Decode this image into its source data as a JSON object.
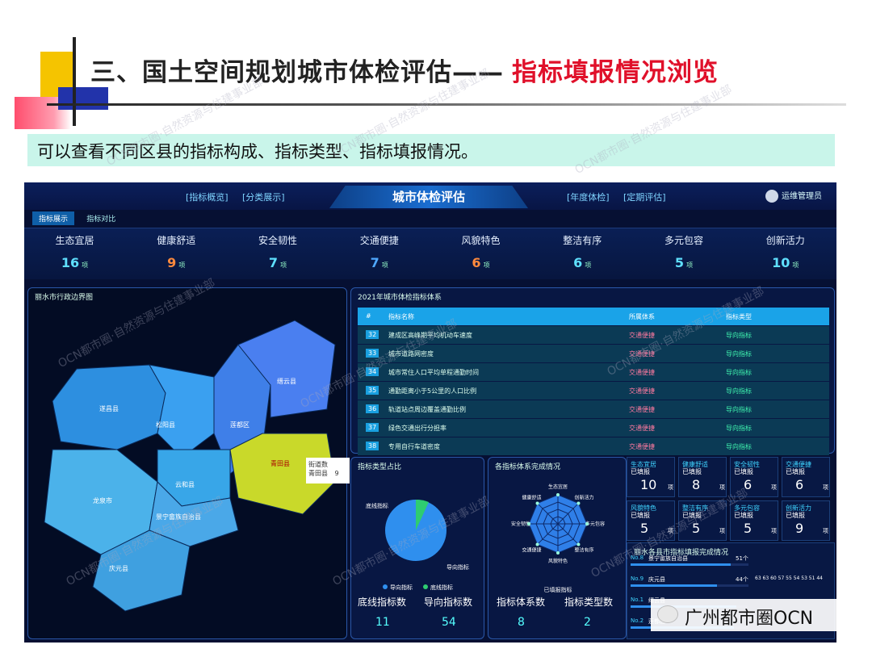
{
  "header": {
    "title": "三、国土空间规划城市体检评估——",
    "title_highlight": "指标填报情况浏览",
    "subtitle": "可以查看不同区县的指标构成、指标类型、指标填报情况。"
  },
  "dashboard": {
    "nav_left": [
      "[指标概览]",
      "[分类展示]"
    ],
    "center_title": "城市体检评估",
    "nav_right": [
      "[年度体检]",
      "[定期评估]"
    ],
    "user": "运维管理员",
    "subtabs": [
      "指标展示",
      "指标对比"
    ],
    "stats": [
      {
        "label": "生态宜居",
        "value": "16",
        "unit": "项",
        "color": "#5fe0ff"
      },
      {
        "label": "健康舒适",
        "value": "9",
        "unit": "项",
        "color": "#ff8a3d"
      },
      {
        "label": "安全韧性",
        "value": "7",
        "unit": "项",
        "color": "#5fe0ff"
      },
      {
        "label": "交通便捷",
        "value": "7",
        "unit": "项",
        "color": "#4fa8ff"
      },
      {
        "label": "风貌特色",
        "value": "6",
        "unit": "项",
        "color": "#ff8a3d"
      },
      {
        "label": "整洁有序",
        "value": "6",
        "unit": "项",
        "color": "#5fe0ff"
      },
      {
        "label": "多元包容",
        "value": "5",
        "unit": "项",
        "color": "#5fe0ff"
      },
      {
        "label": "创新活力",
        "value": "10",
        "unit": "项",
        "color": "#5fe0ff"
      }
    ],
    "map": {
      "title": "丽水市行政边界图",
      "regions": [
        "遂昌县",
        "松阳县",
        "莲都区",
        "缙云县",
        "青田县",
        "云和县",
        "龙泉市",
        "景宁畲族自治县",
        "庆元县"
      ],
      "tooltip": {
        "label": "街道数",
        "region": "青田县",
        "value": "9"
      }
    },
    "table": {
      "title": "2021年城市体检指标体系",
      "headers": [
        "#",
        "指标名称",
        "所属体系",
        "指标类型"
      ],
      "rows": [
        {
          "n": "32",
          "name": "建成区高峰期平均机动车速度",
          "system": "交通便捷",
          "type": "导向指标"
        },
        {
          "n": "33",
          "name": "城市道路网密度",
          "system": "交通便捷",
          "type": "导向指标"
        },
        {
          "n": "34",
          "name": "城市常住人口平均单程通勤时间",
          "system": "交通便捷",
          "type": "导向指标"
        },
        {
          "n": "35",
          "name": "通勤距离小于5公里的人口比例",
          "system": "交通便捷",
          "type": "导向指标"
        },
        {
          "n": "36",
          "name": "轨道站点周边覆盖通勤比例",
          "system": "交通便捷",
          "type": "导向指标"
        },
        {
          "n": "37",
          "name": "绿色交通出行分担率",
          "system": "交通便捷",
          "type": "导向指标"
        },
        {
          "n": "38",
          "name": "专用自行车道密度",
          "system": "交通便捷",
          "type": "导向指标"
        }
      ]
    },
    "pie": {
      "title": "指标类型占比",
      "legend": [
        "导向指标",
        "底线指标"
      ],
      "labels": [
        "底线指标",
        "导向指标"
      ],
      "bottom": [
        {
          "label": "底线指标数",
          "value": "11"
        },
        {
          "label": "导向指标数",
          "value": "54"
        }
      ]
    },
    "radar": {
      "title": "各指标体系完成情况",
      "axes": [
        "生态宜居",
        "创新活力",
        "多元包容",
        "整洁有序",
        "风貌特色",
        "交通便捷",
        "安全韧性",
        "健康舒适"
      ],
      "legend": "已填报指标",
      "bottom": [
        {
          "label": "指标体系数",
          "value": "8"
        },
        {
          "label": "指标类型数",
          "value": "2"
        }
      ]
    },
    "cards": [
      {
        "name": "生态宜居",
        "status": "已填报",
        "value": "10",
        "unit": "项"
      },
      {
        "name": "健康舒适",
        "status": "已填报",
        "value": "8",
        "unit": "项"
      },
      {
        "name": "安全韧性",
        "status": "已填报",
        "value": "6",
        "unit": "项"
      },
      {
        "name": "交通便捷",
        "status": "已填报",
        "value": "6",
        "unit": "项"
      },
      {
        "name": "风貌特色",
        "status": "已填报",
        "value": "5",
        "unit": "项"
      },
      {
        "name": "整洁有序",
        "status": "已填报",
        "value": "5",
        "unit": "项"
      },
      {
        "name": "多元包容",
        "status": "已填报",
        "value": "5",
        "unit": "项"
      },
      {
        "name": "创新活力",
        "status": "已填报",
        "value": "9",
        "unit": "项"
      }
    ],
    "ranking": {
      "title": "丽水各县市指标填报完成情况",
      "rows": [
        {
          "no": "No.8",
          "name": "景宁畲族自治县",
          "value": "51个",
          "fill": 0.85
        },
        {
          "no": "No.9",
          "name": "庆元县",
          "value": "44个",
          "fill": 0.73
        },
        {
          "no": "No.1",
          "name": "缙云县",
          "value": "",
          "fill": 0.9
        },
        {
          "no": "No.2",
          "name": "莲都区",
          "value": "",
          "fill": 0.88
        }
      ],
      "spike_values": "63 63 60 57 55 54 53 51 44"
    }
  },
  "watermark": "OCN都市圈·自然资源与住建事业部",
  "logo_text": "广州都市圈OCN"
}
